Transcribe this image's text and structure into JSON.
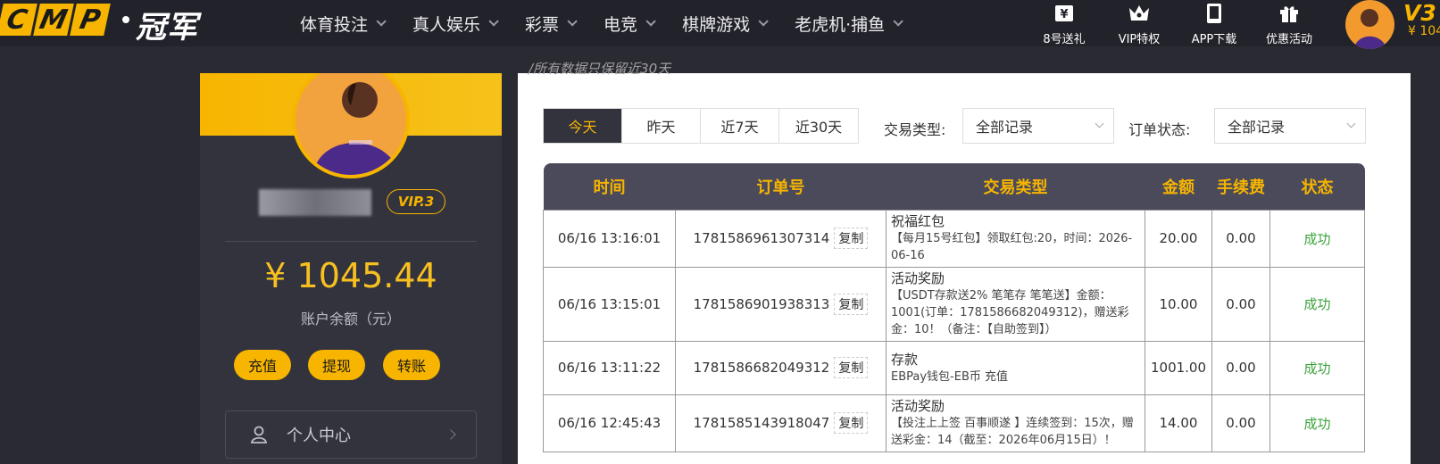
{
  "header": {
    "logo_letters": [
      "C",
      "M",
      "P"
    ],
    "logo_text": "冠军",
    "nav": [
      {
        "label": "体育投注"
      },
      {
        "label": "真人娱乐"
      },
      {
        "label": "彩票"
      },
      {
        "label": "电竞"
      },
      {
        "label": "棋牌游戏"
      },
      {
        "label": "老虎机·捕鱼"
      }
    ],
    "quick_links": [
      {
        "label": "8号送礼",
        "icon": "gift-ticket-icon"
      },
      {
        "label": "VIP特权",
        "icon": "crown-icon"
      },
      {
        "label": "APP下载",
        "icon": "phone-icon"
      },
      {
        "label": "优惠活动",
        "icon": "gift-box-icon"
      }
    ],
    "vip_level": "V3",
    "balance": "¥ 104"
  },
  "profile": {
    "vip_badge": "VIP.3",
    "balance": "¥ 1045.44",
    "balance_label": "账户余额（元）",
    "actions": [
      "充值",
      "提现",
      "转账"
    ],
    "menu_label": "个人中心"
  },
  "filters": {
    "notice": "/所有数据只保留近30天",
    "day_tabs": [
      "今天",
      "昨天",
      "近7天",
      "近30天"
    ],
    "active_tab": "今天",
    "type_label": "交易类型:",
    "type_value": "全部记录",
    "status_label": "订单状态:",
    "status_value": "全部记录"
  },
  "table": {
    "headers": [
      "时间",
      "订单号",
      "交易类型",
      "金额",
      "手续费",
      "状态"
    ],
    "copy_label": "复制",
    "rows": [
      {
        "time": "06/16 13:16:01",
        "order": "1781586961307314",
        "type_title": "祝福红包",
        "type_detail": "【每月15号红包】领取红包:20，时间：2026-06-16",
        "amount": "20.00",
        "fee": "0.00",
        "status": "成功"
      },
      {
        "time": "06/16 13:15:01",
        "order": "1781586901938313",
        "type_title": "活动奖励",
        "type_detail": "【USDT存款送2% 笔笔存 笔笔送】金额：1001(订单：1781586682049312)，赠送彩金：10！（备注：【自助签到】）",
        "amount": "10.00",
        "fee": "0.00",
        "status": "成功"
      },
      {
        "time": "06/16 13:11:22",
        "order": "1781586682049312",
        "type_title": "存款",
        "type_detail": "EBPay钱包-EB币 充值",
        "amount": "1001.00",
        "fee": "0.00",
        "status": "成功"
      },
      {
        "time": "06/16 12:45:43",
        "order": "1781585143918047",
        "type_title": "活动奖励",
        "type_detail": "【投注上上签 百事顺遂 】连续签到：15次，赠送彩金：14（截至：2026年06月15日）！",
        "amount": "14.00",
        "fee": "0.00",
        "status": "成功"
      }
    ]
  },
  "colors": {
    "accent": "#f7b500",
    "dark": "#33333d",
    "success": "#3aa23a"
  }
}
